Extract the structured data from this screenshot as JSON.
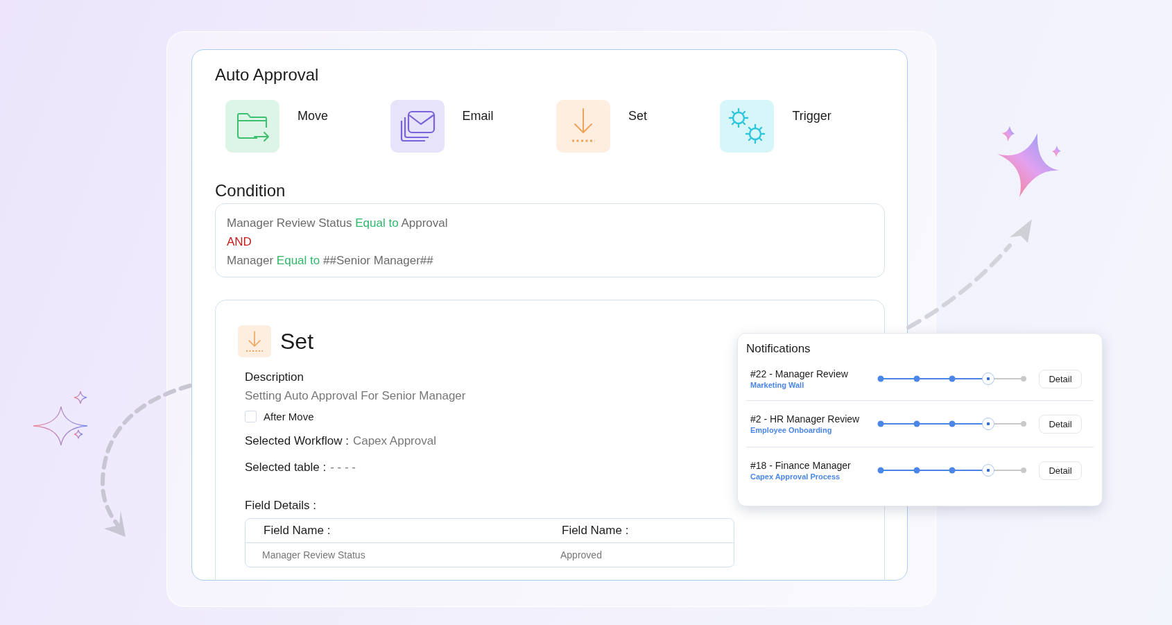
{
  "title": "Auto Approval",
  "actions": [
    {
      "kind": "move",
      "label": "Move"
    },
    {
      "kind": "email",
      "label": "Email"
    },
    {
      "kind": "set",
      "label": "Set"
    },
    {
      "kind": "trigger",
      "label": "Trigger"
    }
  ],
  "condition": {
    "heading": "Condition",
    "lines": [
      [
        {
          "kind": "field",
          "text": "Manager Review Status"
        },
        {
          "kind": "operator",
          "text": "Equal to"
        },
        {
          "kind": "value",
          "text": "Approval"
        }
      ],
      [
        {
          "kind": "conjunction",
          "text": "AND"
        }
      ],
      [
        {
          "kind": "field",
          "text": "Manager"
        },
        {
          "kind": "operator",
          "text": "Equal to"
        },
        {
          "kind": "value",
          "text": "##Senior Manager##"
        }
      ]
    ]
  },
  "set_panel": {
    "title": "Set",
    "description_label": "Description",
    "description": "Setting Auto Approval For Senior Manager",
    "checkbox": {
      "label": "After Move",
      "checked": false
    },
    "details": [
      {
        "label": "Selected Workflow :",
        "value": "Capex Approval"
      },
      {
        "label": "Selected table :",
        "value": "- - - -"
      }
    ],
    "field_details_label": "Field Details :",
    "table": {
      "columns": [
        "Field Name :",
        "Field Name :"
      ],
      "rows": [
        [
          "Manager Review Status",
          "Approved"
        ]
      ]
    }
  },
  "notifications": {
    "title": "Notifications",
    "items": [
      {
        "title": "#22 - Manager Review",
        "subtitle": "Marketing Wall",
        "level": 0.75,
        "button": "Detail"
      },
      {
        "title": "#2 - HR Manager Review",
        "subtitle": "Employee Onboarding",
        "level": 0.75,
        "button": "Detail"
      },
      {
        "title": "#18 - Finance Manager",
        "subtitle": "Capex Approval Process",
        "level": 0.75,
        "button": "Detail"
      }
    ]
  }
}
